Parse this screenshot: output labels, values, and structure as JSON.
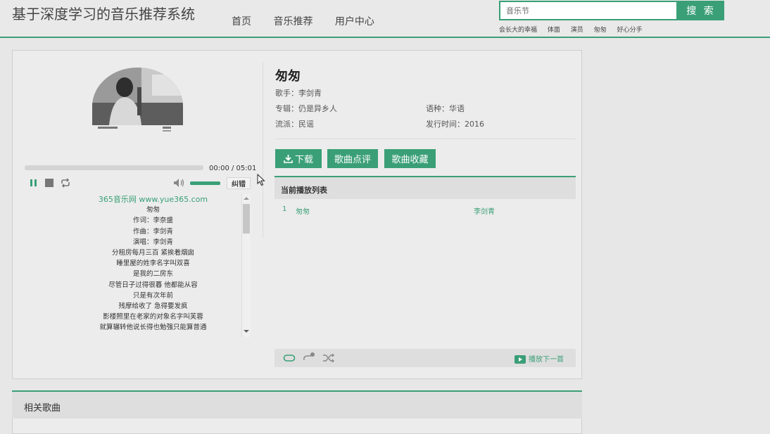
{
  "header": {
    "site_title": "基于深度学习的音乐推荐系统",
    "nav": [
      "首页",
      "音乐推荐",
      "用户中心"
    ],
    "search_value": "音乐节",
    "search_button": "搜 索",
    "hot_searches": [
      "会长大的幸福",
      "体面",
      "演员",
      "匆匆",
      "好心分手"
    ]
  },
  "player": {
    "time": "00:00 / 05:01",
    "correct_label": "纠错",
    "volume_level": 0.85,
    "progress_level": 0,
    "lyrics_site": "365音乐网 www.yue365.com",
    "lyrics": [
      "匆匆",
      "作词：李奈盛",
      "作曲：李剑青",
      "演唱：李剑青",
      "分租房每月三百 紧挨着烟囱",
      "睡里屋的姓李名字叫双喜",
      "是我的二房东",
      "尽管日子过得很暮 他都能从容",
      "只是有次年前",
      "残摩给收了 急得要发疯",
      "影楼照里在老家的对象名字叫芙蓉",
      "就算辗转他说长得也勉强只能算普通"
    ]
  },
  "song": {
    "title": "匆匆",
    "singer": "歌手：李剑青",
    "album": "专辑：仍是异乡人",
    "language": "语种：华语",
    "genre": "流派：民谣",
    "release": "发行时间：2016",
    "download_label": "下载",
    "comment_label": "歌曲点评",
    "favorite_label": "歌曲收藏"
  },
  "playlist": {
    "header": "当前播放列表",
    "rows": [
      {
        "index": "1",
        "title": "匆匆",
        "artist": "李剑青"
      }
    ],
    "next_label": "播放下一首"
  },
  "related": {
    "title": "相关歌曲"
  },
  "colors": {
    "accent": "#3a9f77",
    "background": "#e7e7e7"
  }
}
